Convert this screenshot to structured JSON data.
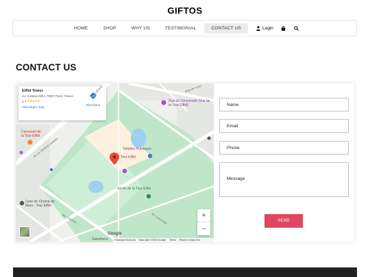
{
  "brand": "GIFTOS",
  "nav": {
    "items": [
      "HOME",
      "SHOP",
      "WHY US",
      "TESTIMONIAL",
      "CONTACT US"
    ],
    "active": "CONTACT US",
    "login_label": "Login",
    "icons": [
      "user-icon",
      "shopping-bag-icon",
      "search-icon"
    ]
  },
  "section": {
    "title": "CONTACT US"
  },
  "map": {
    "place_name": "Eiffel Tower",
    "address": "Av. Gustave Eiffel, 75007 Paris, France",
    "rating": "4.7",
    "stars": "★★★★★",
    "larger_map": "View larger map",
    "directions": "Directions",
    "labels": {
      "tour_eiffel": "Tour Eiffel",
      "toilettes": "Toilettes Publiques",
      "jardin": "Jardin de la Tour Eiffel",
      "universite": "Rue de l'Université (Vue de la Tour Eiffel)",
      "carrousel": "Carrousel de la Tour Eiffel",
      "gare": "Gare de Champ de Mars - Tour Eiffel",
      "salesforce": "Salesforce",
      "quai": "Quai Branly",
      "general_lambert": "Av. du Général Lambert",
      "rue_universite": "Rue de l'Univ",
      "av_lemonnier": "Av. Lemonnier",
      "bd_chandon": "Bd. Chandon"
    },
    "zoom_in": "+",
    "zoom_out": "−",
    "google": "Google",
    "attribution": [
      "Keyboard shortcuts",
      "Map data ©2024 Google",
      "Terms",
      "Report a map error"
    ],
    "colors": {
      "park": "#bfe6c8",
      "water": "#9ed0f0",
      "road": "#ffffff",
      "pin": "#e64a3b"
    }
  },
  "form": {
    "name_placeholder": "Name",
    "email_placeholder": "Email",
    "phone_placeholder": "Phone",
    "message_placeholder": "Message",
    "send_label": "SEND"
  },
  "colors": {
    "accent": "#e0465f",
    "footer": "#222222"
  }
}
